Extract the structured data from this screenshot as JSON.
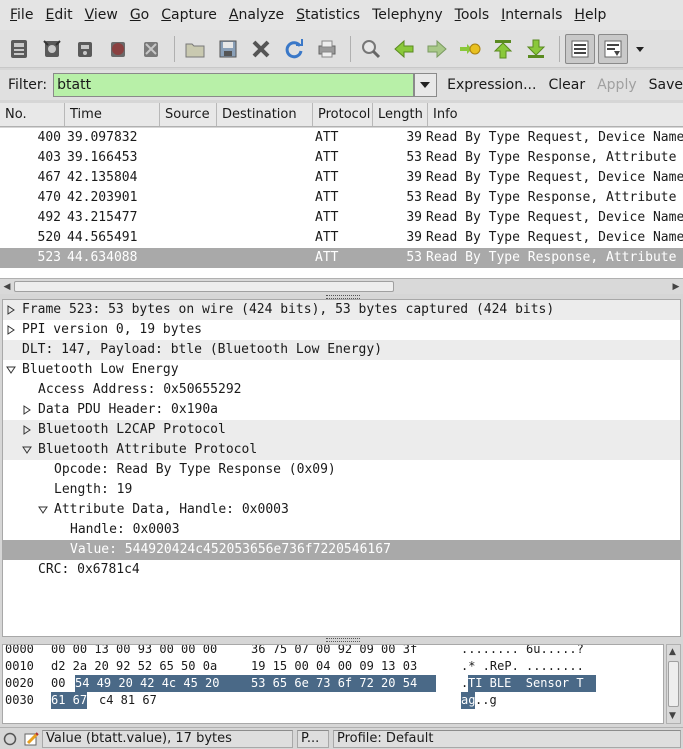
{
  "menubar": {
    "items": [
      {
        "label": "File",
        "u": "F",
        "rest": "ile"
      },
      {
        "label": "Edit",
        "u": "E",
        "rest": "dit"
      },
      {
        "label": "View",
        "u": "V",
        "rest": "iew"
      },
      {
        "label": "Go",
        "u": "G",
        "rest": "o"
      },
      {
        "label": "Capture",
        "u": "C",
        "rest": "apture"
      },
      {
        "label": "Analyze",
        "u": "A",
        "rest": "nalyze"
      },
      {
        "label": "Statistics",
        "u": "S",
        "rest": "tatistics"
      },
      {
        "label": "Telephony",
        "u": "y",
        "pre": "Teleph",
        "post": "ny"
      },
      {
        "label": "Tools",
        "u": "T",
        "rest": "ools"
      },
      {
        "label": "Internals",
        "u": "I",
        "rest": "nternals"
      },
      {
        "label": "Help",
        "u": "H",
        "rest": "elp"
      }
    ]
  },
  "toolbar": {
    "icons": [
      "interface-list-icon",
      "capture-options-icon",
      "start-capture-icon",
      "stop-capture-icon",
      "restart-capture-icon",
      "open-file-icon",
      "save-file-icon",
      "close-file-icon",
      "reload-icon",
      "print-icon",
      "find-packet-icon",
      "go-back-icon",
      "go-forward-icon",
      "go-to-packet-icon",
      "go-first-icon",
      "go-last-icon",
      "colorize-icon",
      "autoscroll-icon",
      "more-icon"
    ]
  },
  "filter": {
    "label": "Filter:",
    "value": "btatt",
    "expression_label": "Expression...",
    "clear_label": "Clear",
    "apply_label": "Apply",
    "save_label": "Save"
  },
  "packet_list": {
    "columns": [
      "No.",
      "Time",
      "Source",
      "Destination",
      "Protocol",
      "Length",
      "Info"
    ],
    "rows": [
      {
        "no": "400",
        "time": "39.097832",
        "source": "",
        "destination": "",
        "protocol": "ATT",
        "length": "39",
        "info": "Read By Type Request, Device Name"
      },
      {
        "no": "403",
        "time": "39.166453",
        "source": "",
        "destination": "",
        "protocol": "ATT",
        "length": "53",
        "info": "Read By Type Response, Attribute"
      },
      {
        "no": "467",
        "time": "42.135804",
        "source": "",
        "destination": "",
        "protocol": "ATT",
        "length": "39",
        "info": "Read By Type Request, Device Name"
      },
      {
        "no": "470",
        "time": "42.203901",
        "source": "",
        "destination": "",
        "protocol": "ATT",
        "length": "53",
        "info": "Read By Type Response, Attribute"
      },
      {
        "no": "492",
        "time": "43.215477",
        "source": "",
        "destination": "",
        "protocol": "ATT",
        "length": "39",
        "info": "Read By Type Request, Device Name"
      },
      {
        "no": "520",
        "time": "44.565491",
        "source": "",
        "destination": "",
        "protocol": "ATT",
        "length": "39",
        "info": "Read By Type Request, Device Name"
      },
      {
        "no": "523",
        "time": "44.634088",
        "source": "",
        "destination": "",
        "protocol": "ATT",
        "length": "53",
        "info": "Read By Type Response, Attribute",
        "selected": true
      }
    ]
  },
  "details": {
    "rows": [
      {
        "text": "Frame 523: 53 bytes on wire (424 bits), 53 bytes captured (424 bits)",
        "level": 0,
        "expander": "collapsed",
        "banded": true
      },
      {
        "text": "PPI version 0, 19 bytes",
        "level": 0,
        "expander": "collapsed",
        "banded": false
      },
      {
        "text": "DLT: 147, Payload: btle (Bluetooth Low Energy)",
        "level": 0,
        "expander": "none",
        "banded": true
      },
      {
        "text": "Bluetooth Low Energy",
        "level": 0,
        "expander": "expanded",
        "banded": false
      },
      {
        "text": "Access Address: 0x50655292",
        "level": 1,
        "expander": "none",
        "banded": false
      },
      {
        "text": "Data PDU Header: 0x190a",
        "level": 1,
        "expander": "collapsed",
        "banded": false
      },
      {
        "text": "Bluetooth L2CAP Protocol",
        "level": 1,
        "expander": "collapsed",
        "banded": true
      },
      {
        "text": "Bluetooth Attribute Protocol",
        "level": 1,
        "expander": "expanded",
        "banded": true
      },
      {
        "text": "Opcode: Read By Type Response (0x09)",
        "level": 2,
        "expander": "none",
        "banded": false
      },
      {
        "text": "Length: 19",
        "level": 2,
        "expander": "none",
        "banded": false
      },
      {
        "text": "Attribute Data, Handle: 0x0003",
        "level": 2,
        "expander": "expanded",
        "banded": false
      },
      {
        "text": "Handle: 0x0003",
        "level": 3,
        "expander": "none",
        "banded": false
      },
      {
        "text": "Value: 544920424c452053656e736f7220546167",
        "level": 3,
        "expander": "none",
        "banded": false,
        "selected": true
      },
      {
        "text": "CRC: 0x6781c4",
        "level": 1,
        "expander": "none",
        "banded": false
      }
    ]
  },
  "hex": {
    "rows": [
      {
        "offset": "0000",
        "hex_a": "00 00 13 00 93 00 00 00",
        "hex_b": "36 75 07 00 92 09 00 3f",
        "ascii": "........ 6u.....?"
      },
      {
        "offset": "0010",
        "hex_a": "d2 2a 20 92 52 65 50 0a",
        "hex_b": "19 15 00 04 00 09 13 03",
        "ascii": ".* .ReP. ........"
      },
      {
        "offset": "0020",
        "hex_pre": "00",
        "hex_sel_a": "54 49 20 42 4c 45 20",
        "hex_sel_b": "53 65 6e 73 6f 72 20 54",
        "ascii_pre": ".",
        "ascii_sel": "TI BLE  Sensor T"
      },
      {
        "offset": "0030",
        "hex_sel": "61 67",
        "hex_rest": "c4 81 67",
        "ascii_sel": "ag",
        "ascii_rest": "..g"
      }
    ]
  },
  "status": {
    "field": "Value (btatt.value), 17 bytes",
    "packets": "P...",
    "profile": "Profile: Default"
  }
}
